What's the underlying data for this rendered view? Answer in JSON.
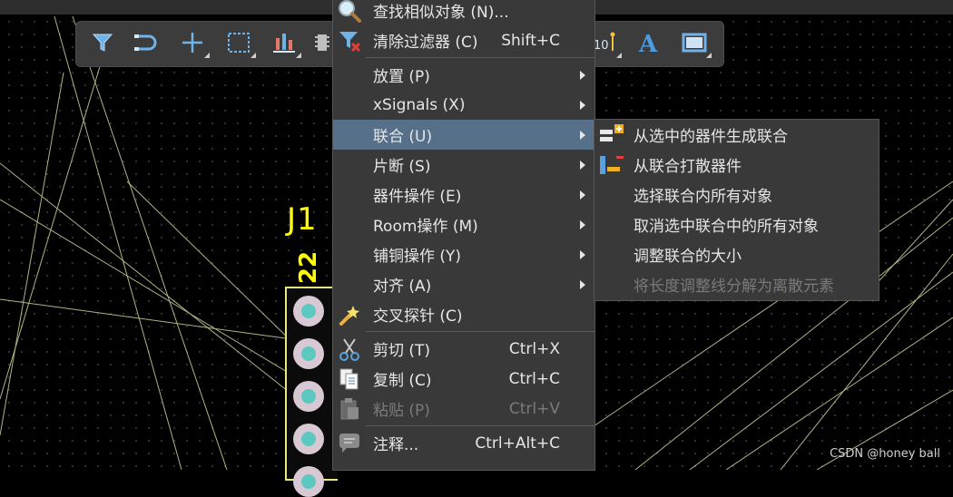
{
  "toolbar": {
    "icons": [
      "filter-icon",
      "route-icon",
      "cross-icon",
      "select-rect-icon",
      "align-bars-icon",
      "component-icon",
      "dimension-icon",
      "text-icon",
      "rectangle-icon"
    ]
  },
  "component": {
    "designator": "J1",
    "pin_label": "22"
  },
  "main_menu": {
    "items": [
      {
        "label": "查找相似对象 (N)...",
        "shortcut": "",
        "icon": "magnifier-icon"
      },
      {
        "label": "清除过滤器 (C)",
        "shortcut": "Shift+C",
        "icon": "clear-filter-icon"
      },
      {
        "label": "放置 (P)",
        "shortcut": "",
        "submenu": true
      },
      {
        "label": "xSignals (X)",
        "shortcut": "",
        "submenu": true
      },
      {
        "label": "联合 (U)",
        "shortcut": "",
        "submenu": true,
        "active": true
      },
      {
        "label": "片断 (S)",
        "shortcut": "",
        "submenu": true
      },
      {
        "label": "器件操作 (E)",
        "shortcut": "",
        "submenu": true
      },
      {
        "label": "Room操作 (M)",
        "shortcut": "",
        "submenu": true
      },
      {
        "label": "铺铜操作 (Y)",
        "shortcut": "",
        "submenu": true
      },
      {
        "label": "对齐 (A)",
        "shortcut": "",
        "submenu": true
      },
      {
        "label": "交叉探针 (C)",
        "shortcut": "",
        "icon": "cross-probe-icon"
      },
      {
        "label": "剪切 (T)",
        "shortcut": "Ctrl+X",
        "icon": "scissors-icon"
      },
      {
        "label": "复制 (C)",
        "shortcut": "Ctrl+C",
        "icon": "copy-icon"
      },
      {
        "label": "粘贴 (P)",
        "shortcut": "Ctrl+V",
        "icon": "paste-icon",
        "disabled": true
      },
      {
        "label": "注释...",
        "shortcut": "Ctrl+Alt+C",
        "icon": "comment-icon"
      }
    ]
  },
  "sub_menu": {
    "items": [
      {
        "label": "从选中的器件生成联合",
        "icon": "create-union-icon"
      },
      {
        "label": "从联合打散器件",
        "icon": "break-union-icon"
      },
      {
        "label": "选择联合内所有对象"
      },
      {
        "label": "取消选中联合中的所有对象"
      },
      {
        "label": "调整联合的大小"
      },
      {
        "label": "将长度调整线分解为离散元素",
        "disabled": true
      }
    ]
  },
  "watermark": "CSDN @honey ball"
}
